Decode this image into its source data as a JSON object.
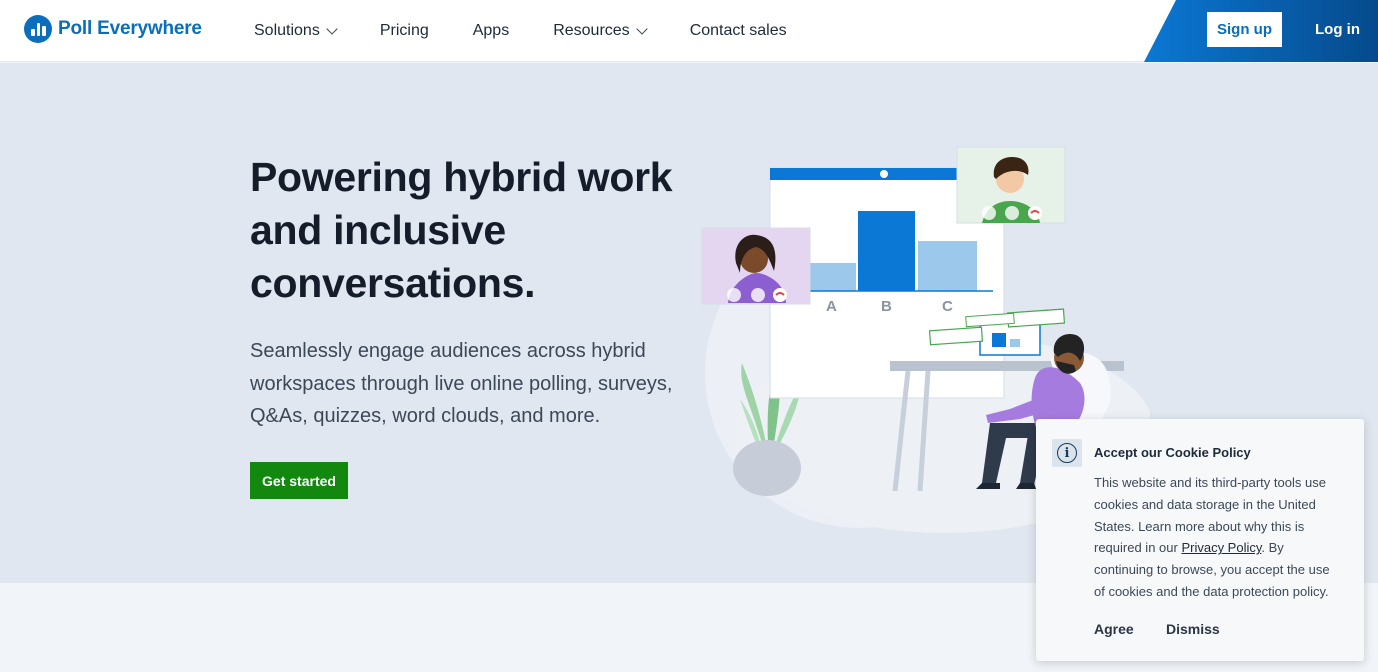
{
  "header": {
    "brand": "Poll Everywhere",
    "nav": [
      {
        "label": "Solutions",
        "dropdown": true
      },
      {
        "label": "Pricing",
        "dropdown": false
      },
      {
        "label": "Apps",
        "dropdown": false
      },
      {
        "label": "Resources",
        "dropdown": true
      },
      {
        "label": "Contact sales",
        "dropdown": false
      }
    ],
    "signup_label": "Sign up",
    "login_label": "Log in"
  },
  "hero": {
    "headline": "Powering hybrid work and inclusive conversations.",
    "subheadline": "Seamlessly engage audiences across hybrid workspaces through live online polling, surveys, Q&As, quizzes, word clouds, and more.",
    "cta_label": "Get started",
    "cta_color": "#12880f",
    "illustration_bars": [
      {
        "label": "A",
        "value": 0.35
      },
      {
        "label": "B",
        "value": 1.0
      },
      {
        "label": "C",
        "value": 0.62
      }
    ]
  },
  "cookie": {
    "title": "Accept our Cookie Policy",
    "body_before_link": "This website and its third-party tools use cookies and data storage in the United States. Learn more about why this is required in our ",
    "link_text": "Privacy Policy",
    "body_after_link": ". By continuing to browse, you accept the use of cookies and the data protection policy.",
    "agree_label": "Agree",
    "dismiss_label": "Dismiss"
  },
  "colors": {
    "brand": "#0a6ebd",
    "hero_bg": "#e1e7f0",
    "accent_green": "#12880f"
  }
}
